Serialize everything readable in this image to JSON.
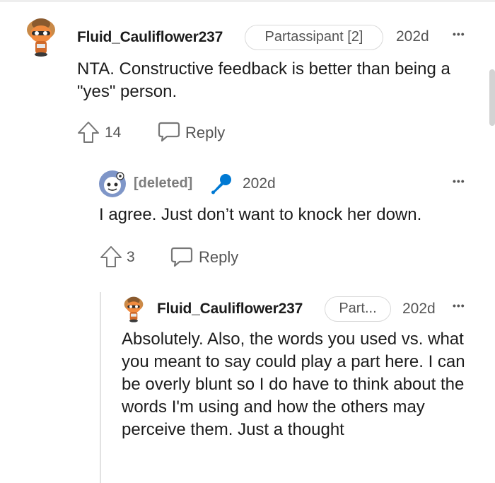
{
  "comments": [
    {
      "author": "Fluid_Cauliflower237",
      "flair": "Partassipant [2]",
      "age": "202d",
      "more": "•••",
      "body": "NTA. Constructive feedback is better than being a \"yes\" person.",
      "votes": "14",
      "reply_label": "Reply",
      "avatar": "snoo-avatar-orange"
    },
    {
      "author": "[deleted]",
      "badge_icon": "microphone-icon",
      "age": "202d",
      "more": "•••",
      "body": "I agree. Just don’t want to knock her down.",
      "votes": "3",
      "reply_label": "Reply",
      "avatar": "snoo-avatar-default"
    },
    {
      "author": "Fluid_Cauliflower237",
      "flair": "Part...",
      "age": "202d",
      "more": "•••",
      "body": "Absolutely. Also, the words you used vs. what you meant to say could play a part here. I can be overly blunt so I do have to think about the words I'm using and how the others may perceive them. Just a thought",
      "avatar": "snoo-avatar-orange"
    }
  ],
  "colors": {
    "accent_blue": "#0079d3",
    "text_primary": "#1c1c1c",
    "text_secondary": "#555555",
    "thread_line": "#e2e2e2"
  }
}
